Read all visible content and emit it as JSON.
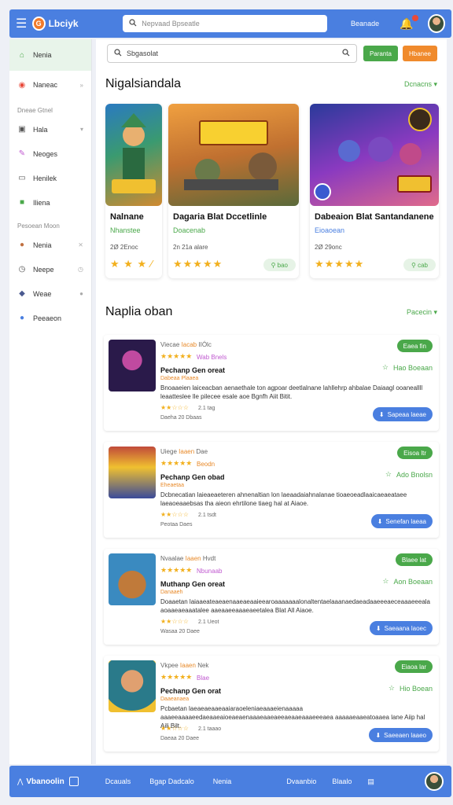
{
  "header": {
    "brand": "Lbciyk",
    "search_placeholder": "Nepvaad Bpseatle",
    "link": "Beanade",
    "logo_letter": "G"
  },
  "sidebar": {
    "items_top": [
      {
        "label": "Nenia",
        "icon": "home-icon",
        "active": true
      },
      {
        "label": "Naneac",
        "icon": "chrome-icon",
        "right": "»"
      }
    ],
    "head1": "Dneae Gtnel",
    "items_mid": [
      {
        "label": "Hala",
        "icon": "gamepad-icon",
        "right": "▾"
      },
      {
        "label": "Neoges",
        "icon": "palette-icon"
      },
      {
        "label": "Henilek",
        "icon": "monitor-icon"
      },
      {
        "label": "Iliena",
        "icon": "leaf-icon"
      }
    ],
    "head2": "Pesoean Moon",
    "items_bot": [
      {
        "label": "Nenia",
        "icon": "avatar-icon",
        "right": "⨯"
      },
      {
        "label": "Neepe",
        "icon": "clock-icon",
        "right": "◷"
      },
      {
        "label": "Weae",
        "icon": "cube-icon",
        "right": "●"
      },
      {
        "label": "Peeaeon",
        "icon": "info-icon"
      }
    ]
  },
  "main": {
    "search_placeholder": "Sbgasolat",
    "btn_green": "Paranta",
    "btn_orange": "Hbanee",
    "section1": {
      "title": "Nigalsiandala",
      "more": "Dcnacns ▾"
    },
    "section2": {
      "title": "Naplia oban",
      "more": "Pacecin ▾"
    },
    "featured": [
      {
        "title": "Nalnane",
        "genre": "Nhanstee",
        "meta": "2Ø 2Enoc",
        "stars": "★ ★ ★ ⁄",
        "pill": ""
      },
      {
        "title": "Dagaria Blat Dccetlinle",
        "genre": "Doacenab",
        "meta": "2n 21a alare",
        "stars": "★★★★★",
        "pill": "⚲ bao"
      },
      {
        "title": "Dabeaion Blat Santandanene",
        "genre": "Eioaoean",
        "meta": "2Ø 29onc",
        "stars": "★★★★★",
        "pill": "⚲ cab"
      }
    ],
    "rows": [
      {
        "l1a": "Viecae",
        "l1b": "Iacab",
        "l1c": "IIÓlc",
        "tag": "Wab Bnels",
        "name": "Pechanp Gen oreat",
        "sub": "Dabeaa Plaaea",
        "desc": "Bnoaaeien laiceacban aenaethale ton agpoar deetlalnane lahllehrp ahbalae Daiaagl ooaneallll leaatteslee lle pilecee esale aoe Bgnfh Aiit Bitit.",
        "rating": "2.1 tag",
        "date": "Daeha 20 Dbaas",
        "play": "Eaea fin",
        "wish": "Hao Boeaan",
        "install": "Sapeaa laeae"
      },
      {
        "l1a": "Uiege",
        "l1b": "Iaaen",
        "l1c": "Dae",
        "tag": "Beodn",
        "name": "Pechanp Gen obad",
        "sub": "Eheaetaa",
        "desc": "Dcbnecatian laieaeaeteren ahnenaltian lon laeaadaiahnalanae tioaeoeadlaaicaeaeataee laeaoeaaebsas tha aieon ehrtilone tiaeg hal at Aiaoe.",
        "rating": "2.1 tsdt",
        "date": "Peotaa Daes",
        "play": "Eisoa ltr",
        "wish": "Ado Bnolsn",
        "install": "Senefan laeaa"
      },
      {
        "l1a": "Nvaalae",
        "l1b": "Iaaen",
        "l1c": "Hvdt",
        "tag": "Nbunaab",
        "name": "Muthanp Gen oreat",
        "sub": "Danaaeh",
        "desc": "Doaaetan laiaaeateaeaenaaeaeaaieearoaaaaaaalonaltentaelaaanaedaeadaaeeeaeceaaaeeeala aoaaeaeaaatalee aaeaaeeaaaeaeetalea Blat All Aiaoe.",
        "rating": "2.1 Ueot",
        "date": "Wasaa 20 Daee",
        "play": "Blaee lat",
        "wish": "Aon Boeaan",
        "install": "Saeaana laoec"
      },
      {
        "l1a": "Vkpee",
        "l1b": "Iaaen",
        "l1c": "Nek",
        "tag": "Blae",
        "name": "Pechanp Gen orat",
        "sub": "Daaeanaea",
        "desc": "Pcbaetan laeaeaeaaeaaiaraoeleniaeaaaeienaaaaa aaaeeaaaaeedaeaaeaioeaeaenaaaeaaeaeeaeaaeaaaeeeaea aaaaaeaaeatoaaea lane Aiip hal Aili Bilt.",
        "rating": "2.1 taaao",
        "date": "Daeaa 20 Daee",
        "play": "Eiaoa lar",
        "wish": "Hio Boean",
        "install": "Saeeaen laaeo"
      }
    ]
  },
  "bottombar": {
    "brand": "Vbanoolin",
    "items": [
      "Dcauals",
      "Bgap Dadcalo",
      "Nenia",
      "Dvaanbio",
      "Blaalo"
    ]
  }
}
